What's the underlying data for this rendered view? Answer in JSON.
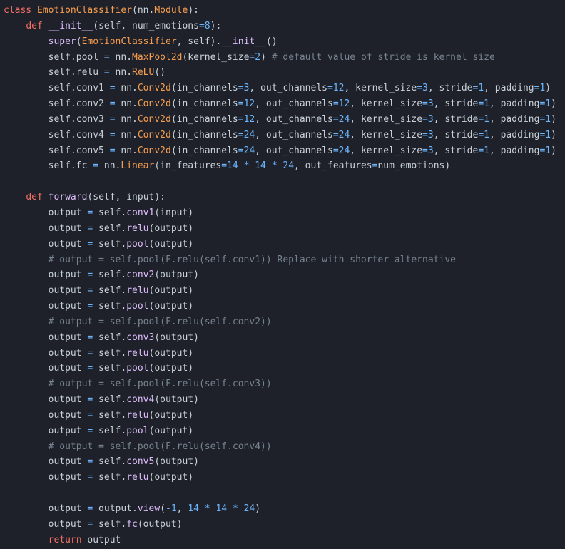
{
  "code": {
    "lines": [
      [
        {
          "t": "class",
          "c": "kw"
        },
        {
          "t": " ",
          "c": "tx"
        },
        {
          "t": "EmotionClassifier",
          "c": "cls"
        },
        {
          "t": "(nn.",
          "c": "tx"
        },
        {
          "t": "Module",
          "c": "cls"
        },
        {
          "t": "):",
          "c": "tx"
        }
      ],
      [
        {
          "t": "    ",
          "c": "tx"
        },
        {
          "t": "def",
          "c": "kw"
        },
        {
          "t": " ",
          "c": "tx"
        },
        {
          "t": "__init__",
          "c": "fn"
        },
        {
          "t": "(self, num_emotions",
          "c": "tx"
        },
        {
          "t": "=8",
          "c": "num"
        },
        {
          "t": "):",
          "c": "tx"
        }
      ],
      [
        {
          "t": "        ",
          "c": "tx"
        },
        {
          "t": "super",
          "c": "fn"
        },
        {
          "t": "(",
          "c": "tx"
        },
        {
          "t": "EmotionClassifier",
          "c": "cls"
        },
        {
          "t": ", self).",
          "c": "tx"
        },
        {
          "t": "__init__",
          "c": "fn"
        },
        {
          "t": "()",
          "c": "tx"
        }
      ],
      [
        {
          "t": "        self.pool ",
          "c": "tx"
        },
        {
          "t": "=",
          "c": "op"
        },
        {
          "t": " nn.",
          "c": "tx"
        },
        {
          "t": "MaxPool2d",
          "c": "cls"
        },
        {
          "t": "(kernel_size",
          "c": "tx"
        },
        {
          "t": "=2",
          "c": "num"
        },
        {
          "t": ") ",
          "c": "tx"
        },
        {
          "t": "# default value of stride is kernel size",
          "c": "cm"
        }
      ],
      [
        {
          "t": "        self.relu ",
          "c": "tx"
        },
        {
          "t": "=",
          "c": "op"
        },
        {
          "t": " nn.",
          "c": "tx"
        },
        {
          "t": "ReLU",
          "c": "cls"
        },
        {
          "t": "()",
          "c": "tx"
        }
      ],
      [
        {
          "t": "        self.conv1 ",
          "c": "tx"
        },
        {
          "t": "=",
          "c": "op"
        },
        {
          "t": " nn.",
          "c": "tx"
        },
        {
          "t": "Conv2d",
          "c": "cls"
        },
        {
          "t": "(in_channels",
          "c": "tx"
        },
        {
          "t": "=3",
          "c": "num"
        },
        {
          "t": ", out_channels",
          "c": "tx"
        },
        {
          "t": "=12",
          "c": "num"
        },
        {
          "t": ", kernel_size",
          "c": "tx"
        },
        {
          "t": "=3",
          "c": "num"
        },
        {
          "t": ", stride",
          "c": "tx"
        },
        {
          "t": "=1",
          "c": "num"
        },
        {
          "t": ", padding",
          "c": "tx"
        },
        {
          "t": "=1",
          "c": "num"
        },
        {
          "t": ")",
          "c": "tx"
        }
      ],
      [
        {
          "t": "        self.conv2 ",
          "c": "tx"
        },
        {
          "t": "=",
          "c": "op"
        },
        {
          "t": " nn.",
          "c": "tx"
        },
        {
          "t": "Conv2d",
          "c": "cls"
        },
        {
          "t": "(in_channels",
          "c": "tx"
        },
        {
          "t": "=12",
          "c": "num"
        },
        {
          "t": ", out_channels",
          "c": "tx"
        },
        {
          "t": "=12",
          "c": "num"
        },
        {
          "t": ", kernel_size",
          "c": "tx"
        },
        {
          "t": "=3",
          "c": "num"
        },
        {
          "t": ", stride",
          "c": "tx"
        },
        {
          "t": "=1",
          "c": "num"
        },
        {
          "t": ", padding",
          "c": "tx"
        },
        {
          "t": "=1",
          "c": "num"
        },
        {
          "t": ")",
          "c": "tx"
        }
      ],
      [
        {
          "t": "        self.conv3 ",
          "c": "tx"
        },
        {
          "t": "=",
          "c": "op"
        },
        {
          "t": " nn.",
          "c": "tx"
        },
        {
          "t": "Conv2d",
          "c": "cls"
        },
        {
          "t": "(in_channels",
          "c": "tx"
        },
        {
          "t": "=12",
          "c": "num"
        },
        {
          "t": ", out_channels",
          "c": "tx"
        },
        {
          "t": "=24",
          "c": "num"
        },
        {
          "t": ", kernel_size",
          "c": "tx"
        },
        {
          "t": "=3",
          "c": "num"
        },
        {
          "t": ", stride",
          "c": "tx"
        },
        {
          "t": "=1",
          "c": "num"
        },
        {
          "t": ", padding",
          "c": "tx"
        },
        {
          "t": "=1",
          "c": "num"
        },
        {
          "t": ")",
          "c": "tx"
        }
      ],
      [
        {
          "t": "        self.conv4 ",
          "c": "tx"
        },
        {
          "t": "=",
          "c": "op"
        },
        {
          "t": " nn.",
          "c": "tx"
        },
        {
          "t": "Conv2d",
          "c": "cls"
        },
        {
          "t": "(in_channels",
          "c": "tx"
        },
        {
          "t": "=24",
          "c": "num"
        },
        {
          "t": ", out_channels",
          "c": "tx"
        },
        {
          "t": "=24",
          "c": "num"
        },
        {
          "t": ", kernel_size",
          "c": "tx"
        },
        {
          "t": "=3",
          "c": "num"
        },
        {
          "t": ", stride",
          "c": "tx"
        },
        {
          "t": "=1",
          "c": "num"
        },
        {
          "t": ", padding",
          "c": "tx"
        },
        {
          "t": "=1",
          "c": "num"
        },
        {
          "t": ")",
          "c": "tx"
        }
      ],
      [
        {
          "t": "        self.conv5 ",
          "c": "tx"
        },
        {
          "t": "=",
          "c": "op"
        },
        {
          "t": " nn.",
          "c": "tx"
        },
        {
          "t": "Conv2d",
          "c": "cls"
        },
        {
          "t": "(in_channels",
          "c": "tx"
        },
        {
          "t": "=24",
          "c": "num"
        },
        {
          "t": ", out_channels",
          "c": "tx"
        },
        {
          "t": "=24",
          "c": "num"
        },
        {
          "t": ", kernel_size",
          "c": "tx"
        },
        {
          "t": "=3",
          "c": "num"
        },
        {
          "t": ", stride",
          "c": "tx"
        },
        {
          "t": "=1",
          "c": "num"
        },
        {
          "t": ", padding",
          "c": "tx"
        },
        {
          "t": "=1",
          "c": "num"
        },
        {
          "t": ")",
          "c": "tx"
        }
      ],
      [
        {
          "t": "        self.fc ",
          "c": "tx"
        },
        {
          "t": "=",
          "c": "op"
        },
        {
          "t": " nn.",
          "c": "tx"
        },
        {
          "t": "Linear",
          "c": "cls"
        },
        {
          "t": "(in_features",
          "c": "tx"
        },
        {
          "t": "=14",
          "c": "num"
        },
        {
          "t": " ",
          "c": "tx"
        },
        {
          "t": "*",
          "c": "op"
        },
        {
          "t": " ",
          "c": "tx"
        },
        {
          "t": "14",
          "c": "num"
        },
        {
          "t": " ",
          "c": "tx"
        },
        {
          "t": "*",
          "c": "op"
        },
        {
          "t": " ",
          "c": "tx"
        },
        {
          "t": "24",
          "c": "num"
        },
        {
          "t": ", out_features",
          "c": "tx"
        },
        {
          "t": "=",
          "c": "op"
        },
        {
          "t": "num_emotions)",
          "c": "tx"
        }
      ],
      [],
      [
        {
          "t": "    ",
          "c": "tx"
        },
        {
          "t": "def",
          "c": "kw"
        },
        {
          "t": " ",
          "c": "tx"
        },
        {
          "t": "forward",
          "c": "fn"
        },
        {
          "t": "(self, input):",
          "c": "tx"
        }
      ],
      [
        {
          "t": "        output ",
          "c": "tx"
        },
        {
          "t": "=",
          "c": "op"
        },
        {
          "t": " self.",
          "c": "tx"
        },
        {
          "t": "conv1",
          "c": "fn"
        },
        {
          "t": "(input)",
          "c": "tx"
        }
      ],
      [
        {
          "t": "        output ",
          "c": "tx"
        },
        {
          "t": "=",
          "c": "op"
        },
        {
          "t": " self.",
          "c": "tx"
        },
        {
          "t": "relu",
          "c": "fn"
        },
        {
          "t": "(output)",
          "c": "tx"
        }
      ],
      [
        {
          "t": "        output ",
          "c": "tx"
        },
        {
          "t": "=",
          "c": "op"
        },
        {
          "t": " self.",
          "c": "tx"
        },
        {
          "t": "pool",
          "c": "fn"
        },
        {
          "t": "(output)",
          "c": "tx"
        }
      ],
      [
        {
          "t": "        ",
          "c": "tx"
        },
        {
          "t": "# output = self.pool(F.relu(self.conv1)) Replace with shorter alternative",
          "c": "cm"
        }
      ],
      [
        {
          "t": "        output ",
          "c": "tx"
        },
        {
          "t": "=",
          "c": "op"
        },
        {
          "t": " self.",
          "c": "tx"
        },
        {
          "t": "conv2",
          "c": "fn"
        },
        {
          "t": "(output)",
          "c": "tx"
        }
      ],
      [
        {
          "t": "        output ",
          "c": "tx"
        },
        {
          "t": "=",
          "c": "op"
        },
        {
          "t": " self.",
          "c": "tx"
        },
        {
          "t": "relu",
          "c": "fn"
        },
        {
          "t": "(output)",
          "c": "tx"
        }
      ],
      [
        {
          "t": "        output ",
          "c": "tx"
        },
        {
          "t": "=",
          "c": "op"
        },
        {
          "t": " self.",
          "c": "tx"
        },
        {
          "t": "pool",
          "c": "fn"
        },
        {
          "t": "(output)",
          "c": "tx"
        }
      ],
      [
        {
          "t": "        ",
          "c": "tx"
        },
        {
          "t": "# output = self.pool(F.relu(self.conv2))",
          "c": "cm"
        }
      ],
      [
        {
          "t": "        output ",
          "c": "tx"
        },
        {
          "t": "=",
          "c": "op"
        },
        {
          "t": " self.",
          "c": "tx"
        },
        {
          "t": "conv3",
          "c": "fn"
        },
        {
          "t": "(output)",
          "c": "tx"
        }
      ],
      [
        {
          "t": "        output ",
          "c": "tx"
        },
        {
          "t": "=",
          "c": "op"
        },
        {
          "t": " self.",
          "c": "tx"
        },
        {
          "t": "relu",
          "c": "fn"
        },
        {
          "t": "(output)",
          "c": "tx"
        }
      ],
      [
        {
          "t": "        output ",
          "c": "tx"
        },
        {
          "t": "=",
          "c": "op"
        },
        {
          "t": " self.",
          "c": "tx"
        },
        {
          "t": "pool",
          "c": "fn"
        },
        {
          "t": "(output)",
          "c": "tx"
        }
      ],
      [
        {
          "t": "        ",
          "c": "tx"
        },
        {
          "t": "# output = self.pool(F.relu(self.conv3))",
          "c": "cm"
        }
      ],
      [
        {
          "t": "        output ",
          "c": "tx"
        },
        {
          "t": "=",
          "c": "op"
        },
        {
          "t": " self.",
          "c": "tx"
        },
        {
          "t": "conv4",
          "c": "fn"
        },
        {
          "t": "(output)",
          "c": "tx"
        }
      ],
      [
        {
          "t": "        output ",
          "c": "tx"
        },
        {
          "t": "=",
          "c": "op"
        },
        {
          "t": " self.",
          "c": "tx"
        },
        {
          "t": "relu",
          "c": "fn"
        },
        {
          "t": "(output)",
          "c": "tx"
        }
      ],
      [
        {
          "t": "        output ",
          "c": "tx"
        },
        {
          "t": "=",
          "c": "op"
        },
        {
          "t": " self.",
          "c": "tx"
        },
        {
          "t": "pool",
          "c": "fn"
        },
        {
          "t": "(output)",
          "c": "tx"
        }
      ],
      [
        {
          "t": "        ",
          "c": "tx"
        },
        {
          "t": "# output = self.pool(F.relu(self.conv4))",
          "c": "cm"
        }
      ],
      [
        {
          "t": "        output ",
          "c": "tx"
        },
        {
          "t": "=",
          "c": "op"
        },
        {
          "t": " self.",
          "c": "tx"
        },
        {
          "t": "conv5",
          "c": "fn"
        },
        {
          "t": "(output)",
          "c": "tx"
        }
      ],
      [
        {
          "t": "        output ",
          "c": "tx"
        },
        {
          "t": "=",
          "c": "op"
        },
        {
          "t": " self.",
          "c": "tx"
        },
        {
          "t": "relu",
          "c": "fn"
        },
        {
          "t": "(output)",
          "c": "tx"
        }
      ],
      [],
      [
        {
          "t": "        output ",
          "c": "tx"
        },
        {
          "t": "=",
          "c": "op"
        },
        {
          "t": " output.",
          "c": "tx"
        },
        {
          "t": "view",
          "c": "fn"
        },
        {
          "t": "(",
          "c": "tx"
        },
        {
          "t": "-1",
          "c": "num"
        },
        {
          "t": ", ",
          "c": "tx"
        },
        {
          "t": "14",
          "c": "num"
        },
        {
          "t": " ",
          "c": "tx"
        },
        {
          "t": "*",
          "c": "op"
        },
        {
          "t": " ",
          "c": "tx"
        },
        {
          "t": "14",
          "c": "num"
        },
        {
          "t": " ",
          "c": "tx"
        },
        {
          "t": "*",
          "c": "op"
        },
        {
          "t": " ",
          "c": "tx"
        },
        {
          "t": "24",
          "c": "num"
        },
        {
          "t": ")",
          "c": "tx"
        }
      ],
      [
        {
          "t": "        output ",
          "c": "tx"
        },
        {
          "t": "=",
          "c": "op"
        },
        {
          "t": " self.",
          "c": "tx"
        },
        {
          "t": "fc",
          "c": "fn"
        },
        {
          "t": "(output)",
          "c": "tx"
        }
      ],
      [
        {
          "t": "        ",
          "c": "tx"
        },
        {
          "t": "return",
          "c": "kw"
        },
        {
          "t": " output",
          "c": "tx"
        }
      ]
    ]
  },
  "colors": {
    "background": "#1e2129",
    "keyword": "#f47067",
    "class": "#f69d50",
    "function": "#dcbdfb",
    "number": "#6cb6ff",
    "comment": "#768390",
    "text": "#c9d1d9"
  }
}
